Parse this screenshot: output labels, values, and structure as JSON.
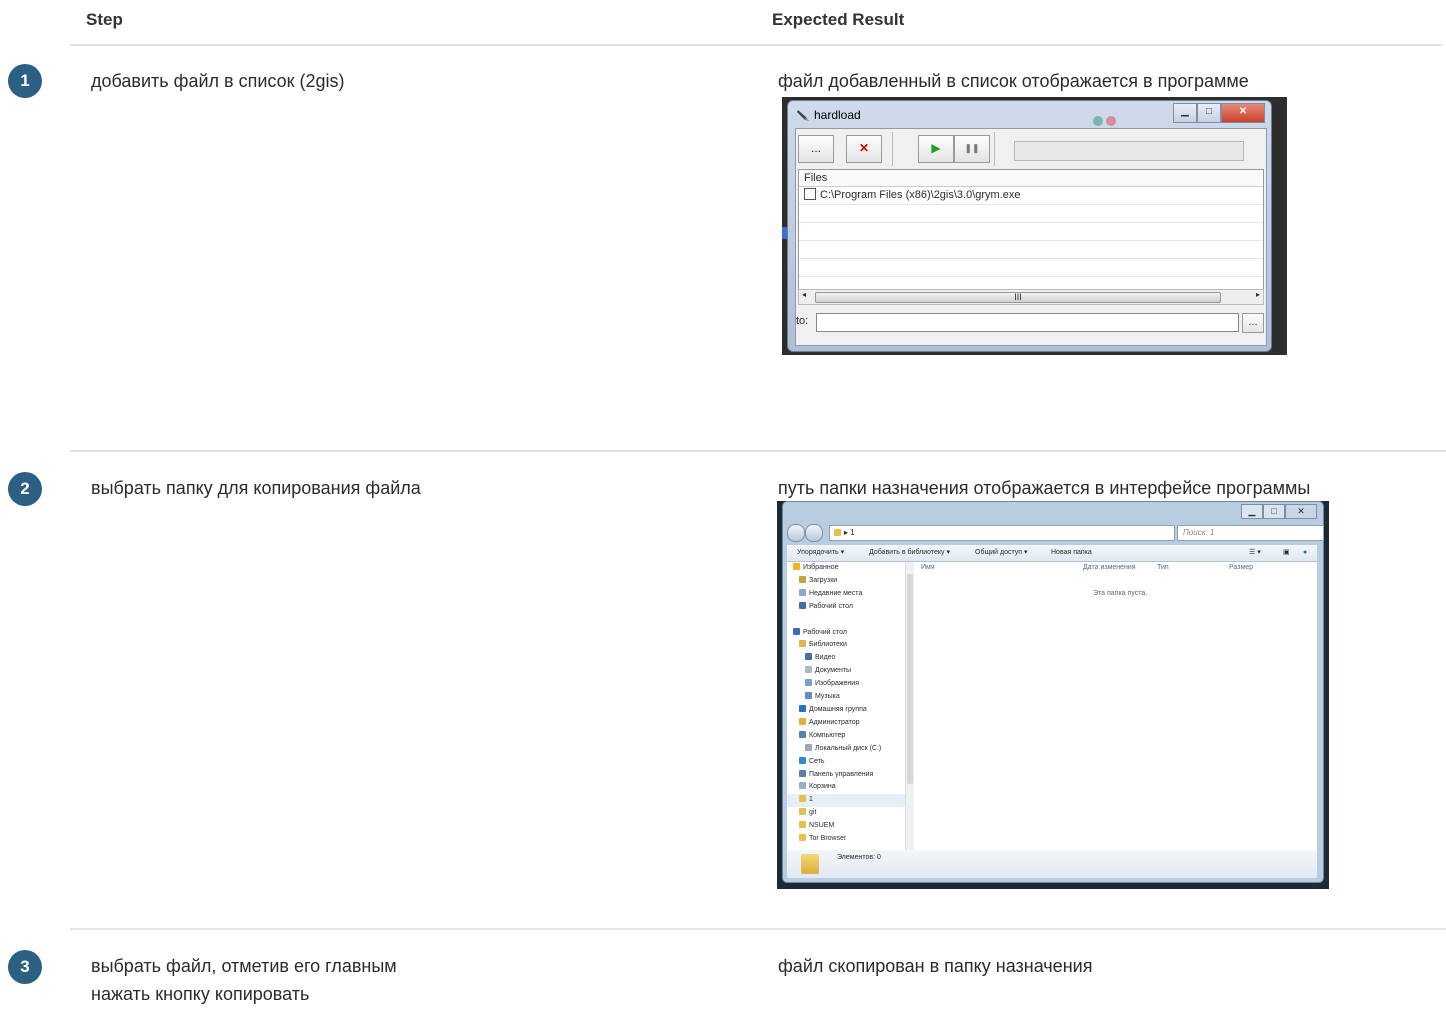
{
  "header": {
    "step_label": "Step",
    "expected_label": "Expected Result"
  },
  "steps": [
    {
      "num": "1",
      "text": "добавить файл в список (2gis)",
      "expected": "файл добавленный в список отображается в программе"
    },
    {
      "num": "2",
      "text": "выбрать папку для копирования файла",
      "expected": "путь папки назначения отображается в интерфейсе программы"
    },
    {
      "num": "3",
      "text": "выбрать файл, отметив его главным\nнажать кнопку копировать",
      "expected": "файл скопирован в папку назначения"
    }
  ],
  "hardload": {
    "title": "hardload",
    "browse_label": "...",
    "remove_label": "✕",
    "play_label": "▶",
    "pause_label": "❚❚",
    "files_header": "Files",
    "file_path": "C:\\Program Files (x86)\\2gis\\3.0\\grym.exe",
    "scroll_grip": "III",
    "to_label": "to:",
    "to_browse_label": "...",
    "colors": {
      "remove": "#d40000",
      "play": "#1aa31a"
    }
  },
  "explorer": {
    "address": "▸ 1",
    "search_placeholder": "Поиск: 1",
    "toolbar": [
      "Упорядочить ▾",
      "Добавить в библиотеку ▾",
      "Общий доступ ▾",
      "Новая папка"
    ],
    "tree": [
      "Избранное",
      "Загрузки",
      "Недавние места",
      "Рабочий стол",
      "",
      "Рабочий стол",
      "Библиотеки",
      "Видео",
      "Документы",
      "Изображения",
      "Музыка",
      "Домашняя группа",
      "Администратор",
      "Компьютер",
      "Локальный диск (C:)",
      "Сеть",
      "Панель управления",
      "Корзина",
      "1",
      "git",
      "NSUEM",
      "Tor Browser"
    ],
    "columns": [
      "Имя",
      "Дата изменения",
      "Тип",
      "Размер"
    ],
    "empty_text": "Эта папка пуста.",
    "status_text": "Элементов: 0"
  }
}
